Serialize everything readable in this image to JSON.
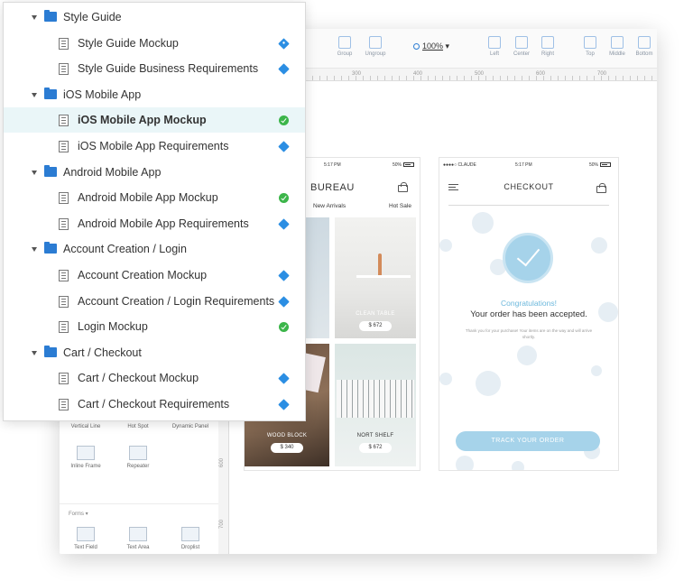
{
  "toolbar": {
    "tools": [
      "Group",
      "Ungroup",
      "Left",
      "Center",
      "Right",
      "Top",
      "Middle",
      "Bottom"
    ],
    "zoom": "100%"
  },
  "ruler": {
    "ticks": [
      "300",
      "400",
      "500",
      "600",
      "700"
    ],
    "vertical_ticks": [
      "600",
      "700"
    ]
  },
  "widgets": {
    "row1": [
      "Vertical Line",
      "Hot Spot",
      "Dynamic Panel"
    ],
    "row2": [
      "Inline Frame",
      "Repeater"
    ],
    "forms_label": "Forms ▾",
    "row3": [
      "Text Field",
      "Text Area",
      "Droplist"
    ]
  },
  "phone1": {
    "time": "5:17 PM",
    "battery": "50%",
    "brand": "BUREAU",
    "nav_left": "New Arrivals",
    "nav_right": "Hot Sale",
    "tiles": [
      {
        "label": "CLEAN TABLE",
        "price": "$ 672"
      },
      {
        "label": "WOOD BLOCK",
        "price": "$ 340"
      },
      {
        "label": "NORT SHELF",
        "price": "$ 672"
      }
    ]
  },
  "phone2": {
    "carrier": "●●●●○ CLAUDE",
    "time": "5:17 PM",
    "battery": "50%",
    "title": "CHECKOUT",
    "congrats": "Congratulations!",
    "accepted": "Your order has been accepted.",
    "thanks": "Thank you for your purchase! Your items are on the way and will arrive shortly.",
    "track_button": "TRACK YOUR ORDER"
  },
  "tree": {
    "rows": [
      {
        "type": "folder",
        "label": "Style Guide"
      },
      {
        "type": "page",
        "label": "Style Guide Mockup",
        "status": "diamond-outline"
      },
      {
        "type": "page",
        "label": "Style Guide Business Requirements",
        "status": "diamond"
      },
      {
        "type": "folder",
        "label": "iOS Mobile App"
      },
      {
        "type": "page",
        "label": "iOS Mobile App Mockup",
        "status": "check",
        "selected": true
      },
      {
        "type": "page",
        "label": "iOS Mobile App Requirements",
        "status": "diamond"
      },
      {
        "type": "folder",
        "label": "Android Mobile App"
      },
      {
        "type": "page",
        "label": "Android Mobile App Mockup",
        "status": "check"
      },
      {
        "type": "page",
        "label": "Android Mobile App Requirements",
        "status": "diamond"
      },
      {
        "type": "folder",
        "label": "Account Creation / Login"
      },
      {
        "type": "page",
        "label": "Account Creation Mockup",
        "status": "diamond"
      },
      {
        "type": "page",
        "label": "Account Creation / Login Requirements",
        "status": "diamond"
      },
      {
        "type": "page",
        "label": "Login Mockup",
        "status": "check"
      },
      {
        "type": "folder",
        "label": "Cart / Checkout"
      },
      {
        "type": "page",
        "label": "Cart / Checkout Mockup",
        "status": "diamond"
      },
      {
        "type": "page",
        "label": "Cart / Checkout Requirements",
        "status": "diamond"
      }
    ]
  },
  "colors": {
    "accent_blue": "#2b7cd3",
    "status_diamond": "#2b8ee3",
    "status_check": "#3cb54a",
    "selected_row": "#eaf6f8",
    "checkout_accent": "#a6d3ea"
  }
}
